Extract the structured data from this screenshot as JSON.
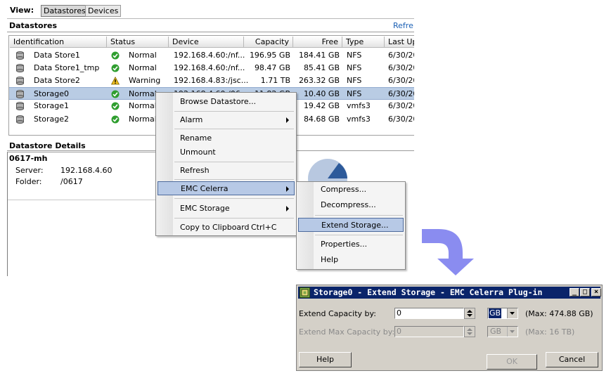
{
  "view_bar": {
    "label": "View:",
    "tabs": [
      "Datastores",
      "Devices"
    ]
  },
  "datastores": {
    "title": "Datastores",
    "refresh": "Refre",
    "columns": [
      "Identification",
      "Status",
      "Device",
      "Capacity",
      "Free",
      "Type",
      "Last Up"
    ],
    "rows": [
      {
        "id": "Data Store1",
        "status": "Normal",
        "status_icon": "check-icon",
        "device": "192.168.4.60:/nf...",
        "capacity": "196.95 GB",
        "free": "184.41 GB",
        "type": "NFS",
        "last": "6/30/20"
      },
      {
        "id": "Data Store1_tmp",
        "status": "Normal",
        "status_icon": "check-icon",
        "device": "192.168.4.60:/nf...",
        "capacity": "98.47 GB",
        "free": "85.41 GB",
        "type": "NFS",
        "last": "6/30/20"
      },
      {
        "id": "Data Store2",
        "status": "Warning",
        "status_icon": "warning-icon",
        "device": "192.168.4.83:/jsc...",
        "capacity": "1.71 TB",
        "free": "263.32 GB",
        "type": "NFS",
        "last": "6/30/20"
      },
      {
        "id": "Storage0",
        "status": "Normal",
        "status_icon": "check-icon",
        "device": "192.168.4.60:/06...",
        "capacity": "11.82 GB",
        "free": "10.40 GB",
        "type": "NFS",
        "last": "6/30/20"
      },
      {
        "id": "Storage1",
        "status": "Normal",
        "status_icon": "check-icon",
        "device": "",
        "capacity": "",
        "free": "19.42 GB",
        "type": "vmfs3",
        "last": "6/30/20"
      },
      {
        "id": "Storage2",
        "status": "Normal",
        "status_icon": "check-icon",
        "device": "",
        "capacity": "",
        "free": "84.68 GB",
        "type": "vmfs3",
        "last": "6/30/20"
      }
    ]
  },
  "details": {
    "title": "Datastore Details",
    "name": "0617-mh",
    "server_label": "Server:",
    "server_value": "192.168.4.60",
    "folder_label": "Folder:",
    "folder_value": "/0617"
  },
  "context_menu": {
    "browse": "Browse Datastore...",
    "alarm": "Alarm",
    "rename": "Rename",
    "unmount": "Unmount",
    "refresh": "Refresh",
    "emc_celerra": "EMC Celerra",
    "emc_storage": "EMC Storage",
    "copy": "Copy to Clipboard",
    "copy_shortcut": "Ctrl+C"
  },
  "submenu": {
    "compress": "Compress...",
    "decompress": "Decompress...",
    "extend": "Extend Storage...",
    "properties": "Properties...",
    "help": "Help"
  },
  "dialog": {
    "title": "Storage0 - Extend Storage - EMC Celerra Plug-in",
    "extend_label": "Extend Capacity by:",
    "extend_value": "0",
    "extend_unit": "GB",
    "extend_max": "(Max: 474.88 GB)",
    "extend_max_label": "Extend Max Capacity by:",
    "extend_max_value": "0",
    "extend_max_unit": "GB",
    "extend_max_max": "(Max: 16 TB)",
    "help_button": "Help",
    "ok_button": "OK",
    "cancel_button": "Cancel"
  },
  "colors": {
    "selection": "#b9cce4",
    "titlebar": "#0a246a",
    "arrow": "#8a8cf0",
    "ok_green": "#2f9e2f",
    "warning": "#f0c020"
  }
}
